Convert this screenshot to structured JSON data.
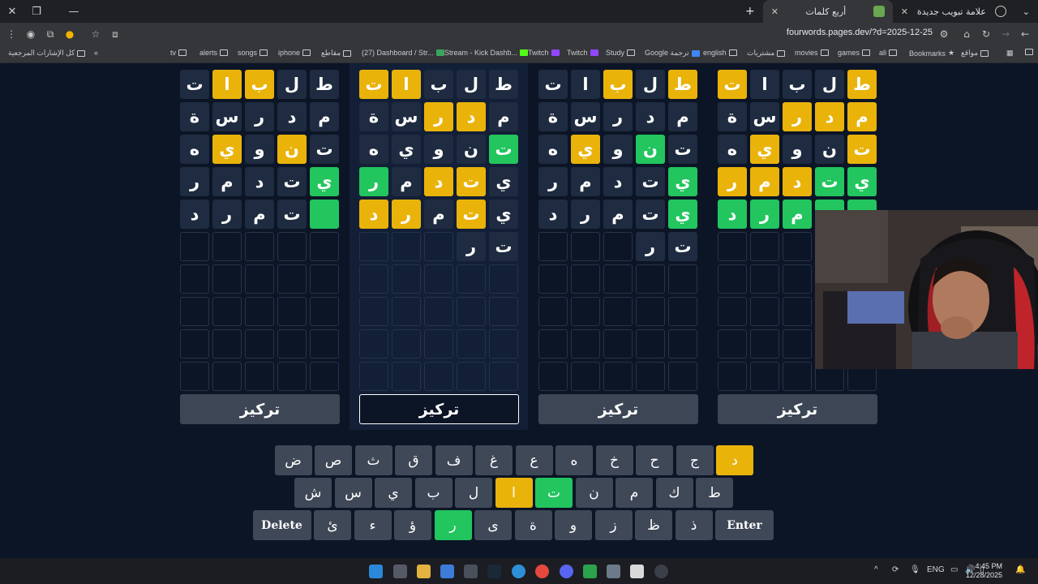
{
  "browser": {
    "tabs": [
      {
        "title": "علامة تبويب جديدة",
        "active": false
      },
      {
        "title": "أربع كلمات",
        "active": true
      }
    ],
    "url": "fourwords.pages.dev/?d=2025-12-25",
    "bookmarks": [
      "كل الإشارات المرجعية",
      "tv",
      "alerts",
      "songs",
      "iphone",
      "مقاطع",
      "(27) Dashboard / Str...",
      "Stream - Kick Dashb...",
      "Twitch",
      "Twitch",
      "Study",
      "Google ترجمة",
      "english",
      "مشتريات",
      "movies",
      "games",
      "ali",
      "Bookmarks",
      "مواقع"
    ]
  },
  "boards": [
    {
      "rows": [
        [
          {
            "l": "ط",
            "s": "yellow"
          },
          {
            "l": "ل",
            "s": "filled"
          },
          {
            "l": "ب",
            "s": "filled"
          },
          {
            "l": "ا",
            "s": "filled"
          },
          {
            "l": "ت",
            "s": "yellow"
          }
        ],
        [
          {
            "l": "م",
            "s": "yellow"
          },
          {
            "l": "د",
            "s": "yellow"
          },
          {
            "l": "ر",
            "s": "yellow"
          },
          {
            "l": "س",
            "s": "filled"
          },
          {
            "l": "ة",
            "s": "filled"
          }
        ],
        [
          {
            "l": "ت",
            "s": "yellow"
          },
          {
            "l": "ن",
            "s": "filled"
          },
          {
            "l": "و",
            "s": "filled"
          },
          {
            "l": "ي",
            "s": "yellow"
          },
          {
            "l": "ه",
            "s": "filled"
          }
        ],
        [
          {
            "l": "ي",
            "s": "green"
          },
          {
            "l": "ت",
            "s": "green"
          },
          {
            "l": "د",
            "s": "yellow"
          },
          {
            "l": "م",
            "s": "yellow"
          },
          {
            "l": "ر",
            "s": "yellow"
          }
        ],
        [
          {
            "l": "ي",
            "s": "green"
          },
          {
            "l": "ت",
            "s": "green"
          },
          {
            "l": "م",
            "s": "green"
          },
          {
            "l": "ر",
            "s": "green"
          },
          {
            "l": "د",
            "s": "green"
          }
        ],
        [
          {
            "l": "",
            "s": "empty"
          },
          {
            "l": "",
            "s": "empty"
          },
          {
            "l": "",
            "s": "empty"
          },
          {
            "l": "",
            "s": "empty"
          },
          {
            "l": "",
            "s": "empty"
          }
        ]
      ],
      "focus_label": "تركيز",
      "active": false
    },
    {
      "rows": [
        [
          {
            "l": "ط",
            "s": "yellow"
          },
          {
            "l": "ل",
            "s": "filled"
          },
          {
            "l": "ب",
            "s": "yellow"
          },
          {
            "l": "ا",
            "s": "filled"
          },
          {
            "l": "ت",
            "s": "filled"
          }
        ],
        [
          {
            "l": "م",
            "s": "filled"
          },
          {
            "l": "د",
            "s": "filled"
          },
          {
            "l": "ر",
            "s": "filled"
          },
          {
            "l": "س",
            "s": "filled"
          },
          {
            "l": "ة",
            "s": "filled"
          }
        ],
        [
          {
            "l": "ت",
            "s": "filled"
          },
          {
            "l": "ن",
            "s": "green"
          },
          {
            "l": "و",
            "s": "filled"
          },
          {
            "l": "ي",
            "s": "yellow"
          },
          {
            "l": "ه",
            "s": "filled"
          }
        ],
        [
          {
            "l": "ي",
            "s": "green"
          },
          {
            "l": "ت",
            "s": "filled"
          },
          {
            "l": "د",
            "s": "filled"
          },
          {
            "l": "م",
            "s": "filled"
          },
          {
            "l": "ر",
            "s": "filled"
          }
        ],
        [
          {
            "l": "ي",
            "s": "green"
          },
          {
            "l": "ت",
            "s": "filled"
          },
          {
            "l": "م",
            "s": "filled"
          },
          {
            "l": "ر",
            "s": "filled"
          },
          {
            "l": "د",
            "s": "filled"
          }
        ],
        [
          {
            "l": "ت",
            "s": "filled"
          },
          {
            "l": "ر",
            "s": "filled"
          },
          {
            "l": "",
            "s": "empty"
          },
          {
            "l": "",
            "s": "empty"
          },
          {
            "l": "",
            "s": "empty"
          }
        ]
      ],
      "focus_label": "تركيز",
      "active": false
    },
    {
      "rows": [
        [
          {
            "l": "ط",
            "s": "filled"
          },
          {
            "l": "ل",
            "s": "filled"
          },
          {
            "l": "ب",
            "s": "filled"
          },
          {
            "l": "ا",
            "s": "yellow"
          },
          {
            "l": "ت",
            "s": "yellow"
          }
        ],
        [
          {
            "l": "م",
            "s": "filled"
          },
          {
            "l": "د",
            "s": "yellow"
          },
          {
            "l": "ر",
            "s": "yellow"
          },
          {
            "l": "س",
            "s": "filled"
          },
          {
            "l": "ة",
            "s": "filled"
          }
        ],
        [
          {
            "l": "ت",
            "s": "green"
          },
          {
            "l": "ن",
            "s": "filled"
          },
          {
            "l": "و",
            "s": "filled"
          },
          {
            "l": "ي",
            "s": "filled"
          },
          {
            "l": "ه",
            "s": "filled"
          }
        ],
        [
          {
            "l": "ي",
            "s": "filled"
          },
          {
            "l": "ت",
            "s": "yellow"
          },
          {
            "l": "د",
            "s": "yellow"
          },
          {
            "l": "م",
            "s": "filled"
          },
          {
            "l": "ر",
            "s": "green"
          }
        ],
        [
          {
            "l": "ي",
            "s": "filled"
          },
          {
            "l": "ت",
            "s": "yellow"
          },
          {
            "l": "م",
            "s": "filled"
          },
          {
            "l": "ر",
            "s": "yellow"
          },
          {
            "l": "د",
            "s": "yellow"
          }
        ],
        [
          {
            "l": "ت",
            "s": "filled"
          },
          {
            "l": "ر",
            "s": "filled"
          },
          {
            "l": "",
            "s": "empty"
          },
          {
            "l": "",
            "s": "empty"
          },
          {
            "l": "",
            "s": "empty"
          }
        ]
      ],
      "focus_label": "تركيز",
      "active": true
    },
    {
      "rows": [
        [
          {
            "l": "ط",
            "s": "filled"
          },
          {
            "l": "ل",
            "s": "filled"
          },
          {
            "l": "ب",
            "s": "yellow"
          },
          {
            "l": "ا",
            "s": "yellow"
          },
          {
            "l": "ت",
            "s": "filled"
          }
        ],
        [
          {
            "l": "م",
            "s": "filled"
          },
          {
            "l": "د",
            "s": "filled"
          },
          {
            "l": "ر",
            "s": "filled"
          },
          {
            "l": "س",
            "s": "filled"
          },
          {
            "l": "ة",
            "s": "filled"
          }
        ],
        [
          {
            "l": "ت",
            "s": "filled"
          },
          {
            "l": "ن",
            "s": "yellow"
          },
          {
            "l": "و",
            "s": "filled"
          },
          {
            "l": "ي",
            "s": "yellow"
          },
          {
            "l": "ه",
            "s": "filled"
          }
        ],
        [
          {
            "l": "ي",
            "s": "green"
          },
          {
            "l": "ت",
            "s": "filled"
          },
          {
            "l": "د",
            "s": "filled"
          },
          {
            "l": "م",
            "s": "filled"
          },
          {
            "l": "ر",
            "s": "filled"
          }
        ],
        [
          {
            "l": "",
            "s": "green"
          },
          {
            "l": "ت",
            "s": "filled"
          },
          {
            "l": "م",
            "s": "filled"
          },
          {
            "l": "ر",
            "s": "filled"
          },
          {
            "l": "د",
            "s": "filled"
          }
        ],
        [
          {
            "l": "",
            "s": "empty"
          },
          {
            "l": "",
            "s": "empty"
          },
          {
            "l": "",
            "s": "empty"
          },
          {
            "l": "",
            "s": "empty"
          },
          {
            "l": "",
            "s": "empty"
          }
        ]
      ],
      "focus_label": "تركيز",
      "active": false
    }
  ],
  "keyboard": {
    "rows": [
      [
        {
          "k": "د",
          "s": "yellow"
        },
        {
          "k": "ج",
          "s": ""
        },
        {
          "k": "ح",
          "s": ""
        },
        {
          "k": "خ",
          "s": ""
        },
        {
          "k": "ه",
          "s": ""
        },
        {
          "k": "ع",
          "s": ""
        },
        {
          "k": "غ",
          "s": ""
        },
        {
          "k": "ف",
          "s": ""
        },
        {
          "k": "ق",
          "s": ""
        },
        {
          "k": "ث",
          "s": ""
        },
        {
          "k": "ص",
          "s": ""
        },
        {
          "k": "ض",
          "s": ""
        }
      ],
      [
        {
          "k": "ط",
          "s": ""
        },
        {
          "k": "ك",
          "s": ""
        },
        {
          "k": "م",
          "s": ""
        },
        {
          "k": "ن",
          "s": ""
        },
        {
          "k": "ت",
          "s": "green"
        },
        {
          "k": "ا",
          "s": "yellow"
        },
        {
          "k": "ل",
          "s": ""
        },
        {
          "k": "ب",
          "s": ""
        },
        {
          "k": "ي",
          "s": ""
        },
        {
          "k": "س",
          "s": ""
        },
        {
          "k": "ش",
          "s": ""
        }
      ],
      [
        {
          "k": "Enter",
          "s": "wide"
        },
        {
          "k": "ذ",
          "s": ""
        },
        {
          "k": "ظ",
          "s": ""
        },
        {
          "k": "ز",
          "s": ""
        },
        {
          "k": "و",
          "s": ""
        },
        {
          "k": "ة",
          "s": ""
        },
        {
          "k": "ى",
          "s": ""
        },
        {
          "k": "ر",
          "s": "green"
        },
        {
          "k": "ؤ",
          "s": ""
        },
        {
          "k": "ء",
          "s": ""
        },
        {
          "k": "ئ",
          "s": ""
        },
        {
          "k": "Delete",
          "s": "wide"
        }
      ]
    ]
  },
  "taskbar": {
    "lang": "ENG",
    "time": "4:45 PM",
    "date": "12/28/2025"
  },
  "colors": {
    "yellow": "#eab30a",
    "green": "#22c55e",
    "background": "#0c1526",
    "tile_border": "#253349",
    "key": "#3f4857"
  }
}
